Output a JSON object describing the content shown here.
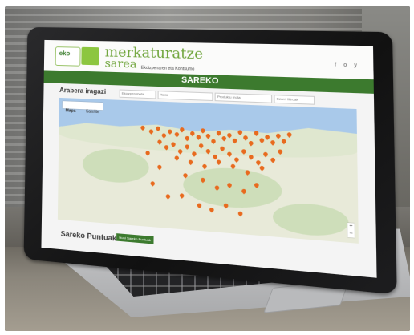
{
  "site": {
    "logo_text": "eko",
    "brand_line1": "merkaturatze",
    "brand_line2": "sarea",
    "brand_sub": "Ekoizpenaren eta Kontsumo",
    "nav_icons": "f o y",
    "page_title": "SAREKO",
    "filter_title": "Arabera iragazi",
    "filter_1": "Ekoizpen mota",
    "filter_2": "Tokia",
    "filter_3": "Produktu mota",
    "filter_4": "Ezarri filtroak",
    "map_tab_map": "Mapa",
    "map_tab_sat": "Satelite",
    "zoom_plus": "+",
    "zoom_minus": "−",
    "section_title": "Sareko Puntuak",
    "section_button": "Ikusi Sareko Puntuak"
  },
  "colors": {
    "brand_green": "#3c7a2e",
    "pin": "#e86a1e",
    "logo_green": "#6ea43a"
  }
}
